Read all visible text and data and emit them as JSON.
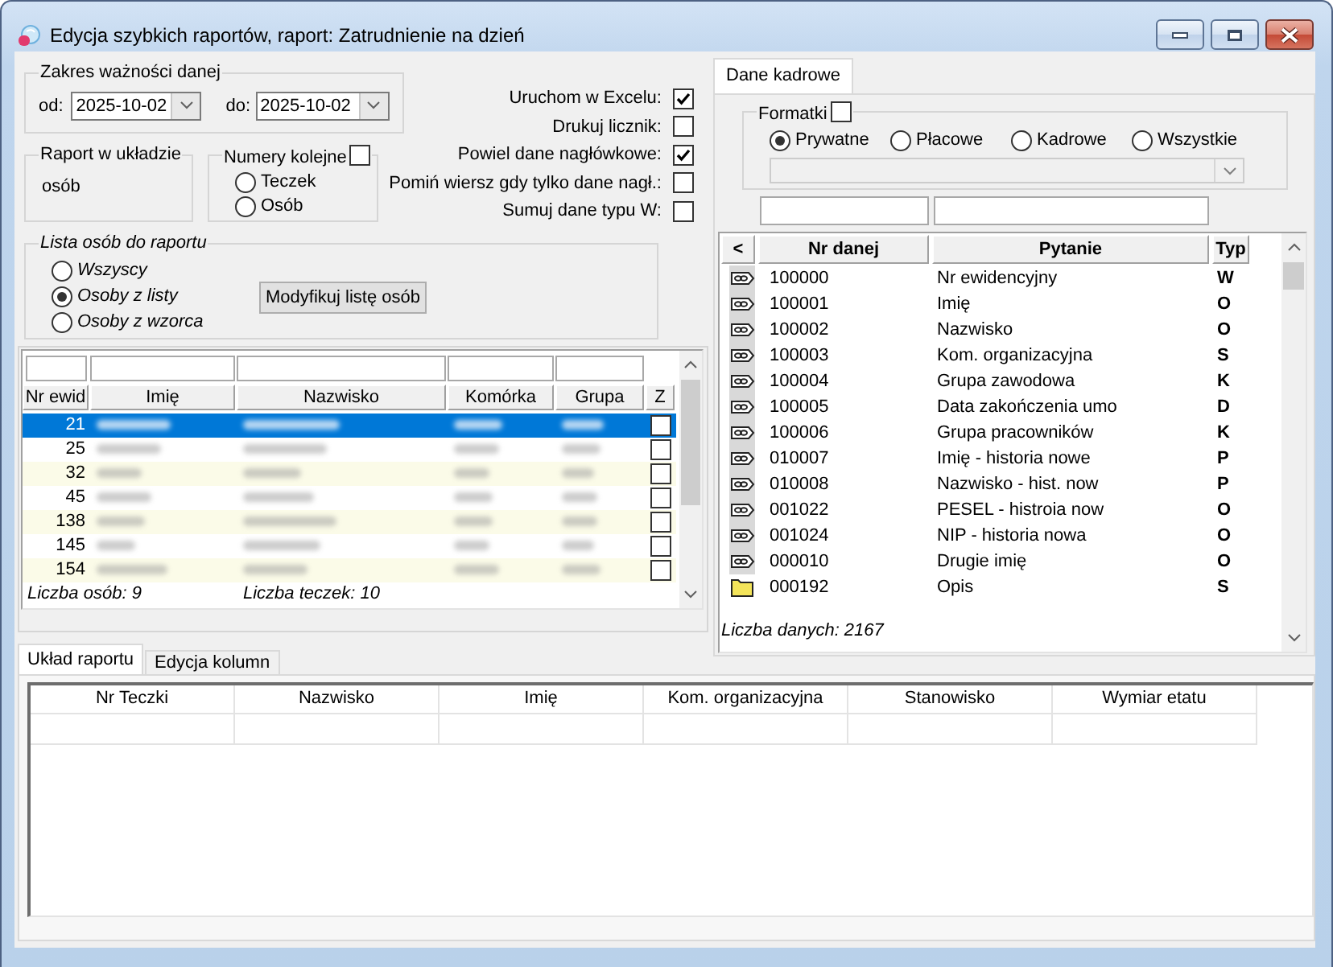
{
  "window": {
    "title": "Edycja szybkich raportów, raport: Zatrudnienie na dzień"
  },
  "date_range": {
    "legend": "Zakres ważności danej",
    "from": {
      "label": "od:",
      "value": "2025-10-02"
    },
    "to": {
      "label": "do:",
      "value": "2025-10-02"
    }
  },
  "options": [
    {
      "label": "Uruchom w Excelu:",
      "checked": true
    },
    {
      "label": "Drukuj licznik:",
      "checked": false
    },
    {
      "label": "Powiel dane nagłówkowe:",
      "checked": true
    },
    {
      "label": "Pomiń wiersz gdy tylko dane nagł.:",
      "checked": false
    },
    {
      "label": "Sumuj dane typu W:",
      "checked": false
    }
  ],
  "report_layout": {
    "legend": "Raport w układzie",
    "value": "osób"
  },
  "numbering": {
    "legend": "Numery kolejne",
    "checked": false,
    "options": [
      {
        "label": "Teczek",
        "selected": false
      },
      {
        "label": "Osób",
        "selected": false
      }
    ]
  },
  "person_list": {
    "legend": "Lista osób do raportu",
    "options": [
      {
        "label": "Wszyscy",
        "selected": false
      },
      {
        "label": "Osoby z listy",
        "selected": true
      },
      {
        "label": "Osoby z wzorca",
        "selected": false
      }
    ],
    "button": "Modyfikuj listę osób"
  },
  "persons_table": {
    "columns": [
      {
        "label": "Nr ewid",
        "filter": true
      },
      {
        "label": "Imię",
        "filter": true
      },
      {
        "label": "Nazwisko",
        "filter": true
      },
      {
        "label": "Komórka",
        "filter": true
      },
      {
        "label": "Grupa",
        "filter": true
      },
      {
        "label": "Z",
        "filter": false
      }
    ],
    "rows": [
      {
        "nr": "21",
        "selected": true,
        "checked": false
      },
      {
        "nr": "25",
        "selected": false,
        "checked": false
      },
      {
        "nr": "32",
        "selected": false,
        "checked": false
      },
      {
        "nr": "45",
        "selected": false,
        "checked": false
      },
      {
        "nr": "138",
        "selected": false,
        "checked": false
      },
      {
        "nr": "145",
        "selected": false,
        "checked": false
      },
      {
        "nr": "154",
        "selected": false,
        "checked": false
      }
    ],
    "footer": [
      "Liczba osób: 9",
      "Liczba teczek: 10"
    ]
  },
  "bottom_tabs": [
    {
      "label": "Układ raportu",
      "selected": true
    },
    {
      "label": "Edycja kolumn",
      "selected": false
    }
  ],
  "right_tabs": [
    {
      "label": "Dane kadrowe",
      "selected": true
    }
  ],
  "formatki": {
    "legend": "Formatki",
    "checked": false,
    "options": [
      {
        "label": "Prywatne",
        "selected": true
      },
      {
        "label": "Płacowe",
        "selected": false
      },
      {
        "label": "Kadrowe",
        "selected": false
      },
      {
        "label": "Wszystkie",
        "selected": false
      }
    ],
    "combo": {
      "disabled": true
    }
  },
  "data_table": {
    "columns": [
      {
        "label": "<",
        "filter": false
      },
      {
        "label": "Nr danej",
        "filter": true
      },
      {
        "label": "Pytanie",
        "filter": true
      },
      {
        "label": "Typ",
        "filter": false
      }
    ],
    "rows": [
      {
        "kind": "field",
        "nr": "100000",
        "question": "Nr ewidencyjny",
        "type": "W"
      },
      {
        "kind": "field",
        "nr": "100001",
        "question": "Imię",
        "type": "O"
      },
      {
        "kind": "field",
        "nr": "100002",
        "question": "Nazwisko",
        "type": "O"
      },
      {
        "kind": "field",
        "nr": "100003",
        "question": "Kom. organizacyjna",
        "type": "S"
      },
      {
        "kind": "field",
        "nr": "100004",
        "question": "Grupa zawodowa",
        "type": "K"
      },
      {
        "kind": "field",
        "nr": "100005",
        "question": "Data zakończenia umo",
        "type": "D"
      },
      {
        "kind": "field",
        "nr": "100006",
        "question": "Grupa pracowników",
        "type": "K"
      },
      {
        "kind": "field",
        "nr": "010007",
        "question": "Imię - historia nowe",
        "type": "P"
      },
      {
        "kind": "field",
        "nr": "010008",
        "question": "Nazwisko - hist. now",
        "type": "P"
      },
      {
        "kind": "field",
        "nr": "001022",
        "question": "PESEL - histroia now",
        "type": "O"
      },
      {
        "kind": "field",
        "nr": "001024",
        "question": "NIP - historia nowa",
        "type": "O"
      },
      {
        "kind": "field",
        "nr": "000010",
        "question": "Drugie imię",
        "type": "O"
      },
      {
        "kind": "folder",
        "nr": "000192",
        "question": "Opis",
        "type": "S"
      }
    ],
    "footer": "Liczba danych: 2167"
  },
  "layout_table": {
    "columns": [
      "Nr Teczki",
      "Nazwisko",
      "Imię",
      "Kom. organizacyjna",
      "Stanowisko",
      "Wymiar etatu"
    ]
  }
}
